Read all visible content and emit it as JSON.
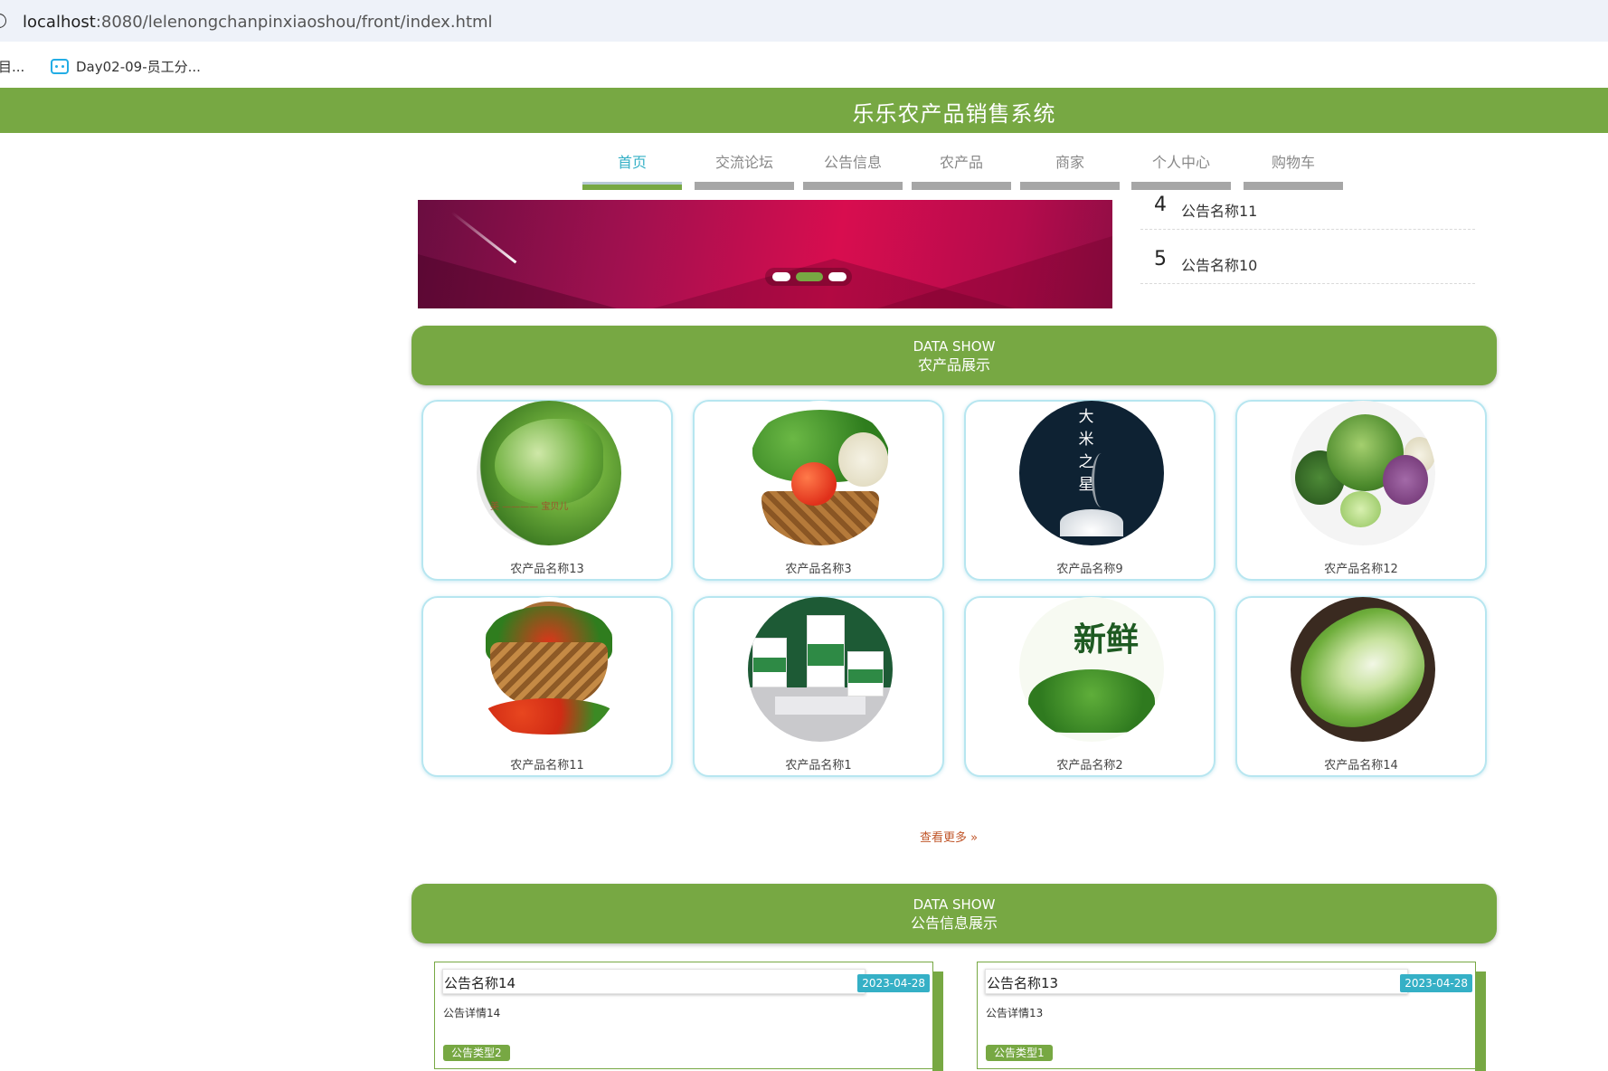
{
  "browser": {
    "url_host": "localhost",
    "url_path": ":8080/lelenongchanpinxiaoshou/front/index.html",
    "bookmarks": [
      "目...",
      "Day02-09-员工分..."
    ]
  },
  "site": {
    "title": "乐乐农产品销售系统"
  },
  "nav": {
    "items": [
      "首页",
      "交流论坛",
      "公告信息",
      "农产品",
      "商家",
      "个人中心",
      "购物车"
    ],
    "active": "首页"
  },
  "side_notices": [
    {
      "num": "4",
      "title": "公告名称11"
    },
    {
      "num": "5",
      "title": "公告名称10"
    }
  ],
  "products_section": {
    "en": "DATA SHOW",
    "cn": "农产品展示"
  },
  "products": [
    {
      "name": "农产品名称13",
      "image": "cabbage-photo",
      "image_text": "美 宝贝儿"
    },
    {
      "name": "农产品名称3",
      "image": "vegetable-basket-photo"
    },
    {
      "name": "农产品名称9",
      "image": "rice-poster",
      "image_text": "大米之星"
    },
    {
      "name": "农产品名称12",
      "image": "assorted-vegetables-photo"
    },
    {
      "name": "农产品名称11",
      "image": "fruit-basket-photo"
    },
    {
      "name": "农产品名称1",
      "image": "packaged-produce-photo"
    },
    {
      "name": "农产品名称2",
      "image": "fresh-vegetables-poster",
      "image_text": "新鲜"
    },
    {
      "name": "农产品名称14",
      "image": "napa-cabbage-photo"
    }
  ],
  "more_label": "查看更多",
  "notices_section": {
    "en": "DATA SHOW",
    "cn": "公告信息展示"
  },
  "notices": [
    {
      "title": "公告名称14",
      "date": "2023-04-28",
      "desc": "公告详情14",
      "type": "公告类型2"
    },
    {
      "title": "公告名称13",
      "date": "2023-04-28",
      "desc": "公告详情13",
      "type": "公告类型1"
    }
  ],
  "colors": {
    "brand_green": "#77a843",
    "accent_teal": "#35b0c6",
    "more_link": "#c0562a"
  }
}
